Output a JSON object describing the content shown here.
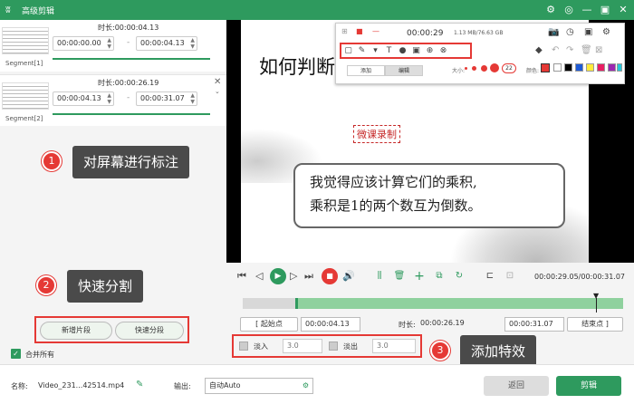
{
  "window": {
    "title": "高级剪辑",
    "logo": "ʬ",
    "ctl_icons": [
      "⚙",
      "◎",
      "▢",
      "—",
      "▣",
      "✕"
    ]
  },
  "segments": [
    {
      "label": "Segment[1]",
      "duration_label": "时长:",
      "duration": "00:00:04.13",
      "start": "00:00:00.00",
      "end": "00:00:04.13"
    },
    {
      "label": "Segment[2]",
      "duration_label": "时长:",
      "duration": "00:00:26.19",
      "start": "00:00:04.13",
      "end": "00:00:31.07"
    }
  ],
  "callouts": [
    {
      "num": "1",
      "text": "对屏幕进行标注"
    },
    {
      "num": "2",
      "text": "快速分割"
    },
    {
      "num": "3",
      "text": "添加特效"
    }
  ],
  "left_actions": {
    "add_segment": "新增片段",
    "quick_split": "快速分段",
    "merge_all": "合并所有"
  },
  "slide": {
    "title": "如何判断",
    "red_label": "微课录制",
    "bubble_line1": "我觉得应该计算它们的乘积,",
    "bubble_line2": "乘积是1的两个数互为倒数。"
  },
  "annotation_toolbar": {
    "time": "00:00:29",
    "size": "1.13 MB/76.63 GB",
    "tab_add": "添加",
    "tab_edit": "编辑",
    "size_label": "大小:",
    "font_size": "22",
    "color_label": "颜色:",
    "colors": [
      "#e53935",
      "#ffffff",
      "#000000",
      "#1e5bd6",
      "#ffeb3b",
      "#e91e63",
      "#9c27b0",
      "#26c6da"
    ],
    "tool_icons": [
      "▢",
      "✎",
      "▾",
      "T",
      "●",
      "▣",
      "⊕",
      "⊗"
    ]
  },
  "timeline": {
    "current": "00:00:29.05/00:00:31.07",
    "start_btn": "起始点",
    "start": "00:00:04.13",
    "duration_label": "时长:",
    "duration": "00:00:26.19",
    "end": "00:00:31.07",
    "end_btn": "结束点",
    "fade_in_label": "淡入",
    "fade_in": "3.0",
    "fade_out_label": "淡出",
    "fade_out": "3.0"
  },
  "bottom": {
    "name_label": "名称:",
    "filename": "Video_231...42514.mp4",
    "output_label": "输出:",
    "output": "自动Auto",
    "back": "返回",
    "edit": "剪辑"
  }
}
